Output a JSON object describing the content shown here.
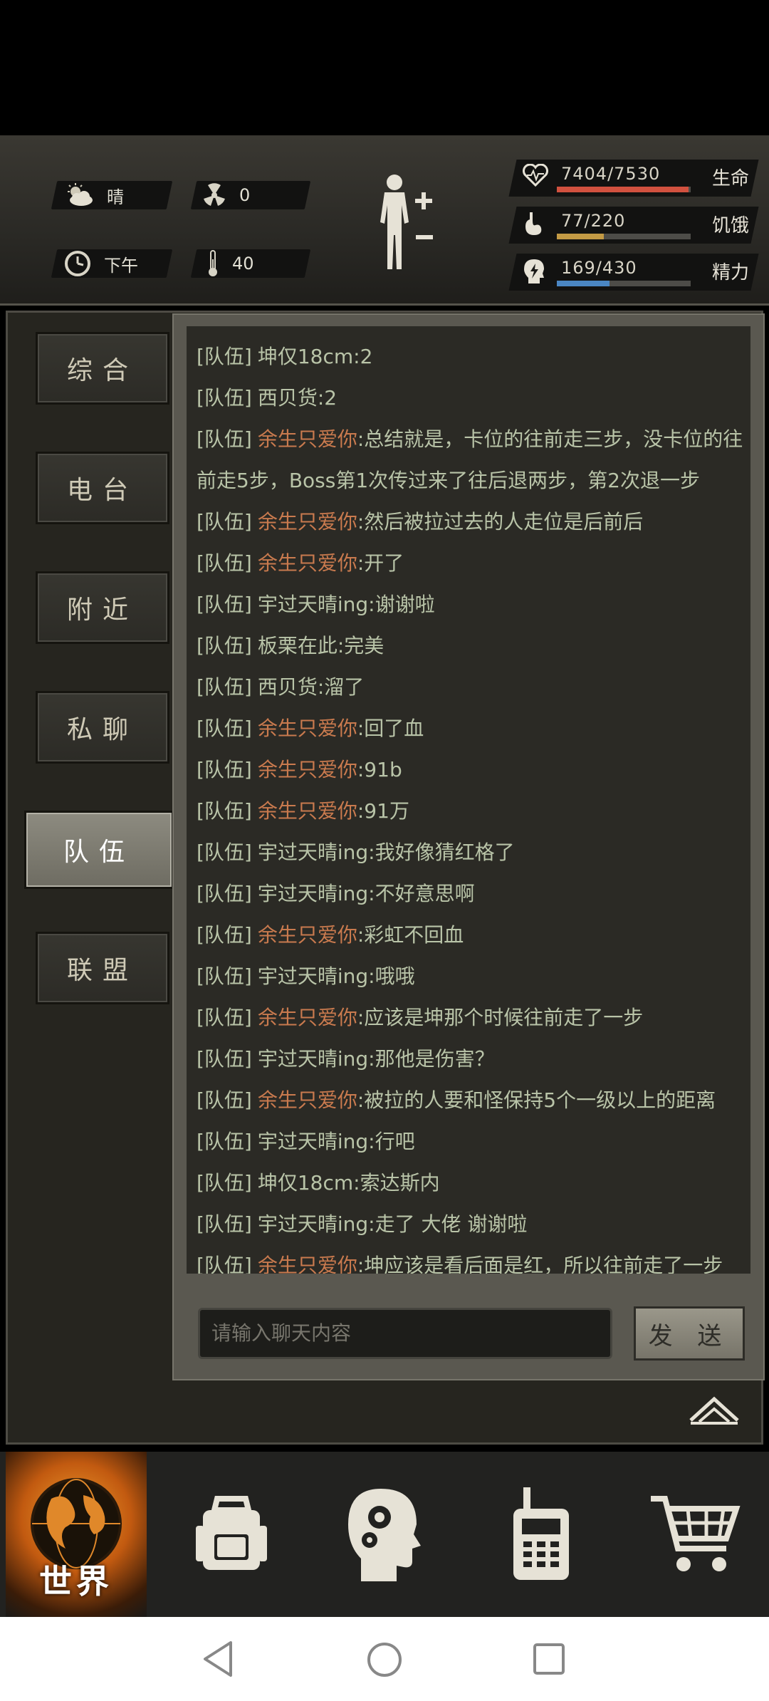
{
  "hud": {
    "weather": "晴",
    "radiation": "0",
    "time_of_day": "下午",
    "temperature": "40",
    "health": {
      "value": "7404/7530",
      "label": "生命",
      "fraction": 0.983,
      "color": "#d1513f"
    },
    "hunger": {
      "value": "77/220",
      "label": "饥饿",
      "fraction": 0.35,
      "color": "#c39a44"
    },
    "energy": {
      "value": "169/430",
      "label": "精力",
      "fraction": 0.393,
      "color": "#4a86c3"
    }
  },
  "tabs": [
    {
      "label": "综合"
    },
    {
      "label": "电台"
    },
    {
      "label": "附近"
    },
    {
      "label": "私聊"
    },
    {
      "label": "队伍",
      "active": true
    },
    {
      "label": "联盟"
    }
  ],
  "chat": {
    "tag": "[队伍]",
    "messages": [
      {
        "name": "坤仅18cm",
        "sender_color": "#b9c4a8",
        "text": ":2"
      },
      {
        "name": "西贝货",
        "sender_color": "#b9c4a8",
        "text": ":2"
      },
      {
        "name": "余生只爱你",
        "sender_color": "#c97a4e",
        "text": ":总结就是，卡位的往前走三步，没卡位的往前走5步，Boss第1次传过来了往后退两步，第2次退一步"
      },
      {
        "name": "余生只爱你",
        "sender_color": "#c97a4e",
        "text": ":然后被拉过去的人走位是后前后"
      },
      {
        "name": "余生只爱你",
        "sender_color": "#c97a4e",
        "text": ":开了"
      },
      {
        "name": "宇过天晴ing",
        "sender_color": "#b9c4a8",
        "text": ":谢谢啦"
      },
      {
        "name": "板栗在此",
        "sender_color": "#b9c4a8",
        "text": ":完美"
      },
      {
        "name": "西贝货",
        "sender_color": "#b9c4a8",
        "text": ":溜了"
      },
      {
        "name": "余生只爱你",
        "sender_color": "#c97a4e",
        "text": ":回了血"
      },
      {
        "name": "余生只爱你",
        "sender_color": "#c97a4e",
        "text": ":91b"
      },
      {
        "name": "余生只爱你",
        "sender_color": "#c97a4e",
        "text": ":91万"
      },
      {
        "name": "宇过天晴ing",
        "sender_color": "#b9c4a8",
        "text": ":我好像猜红格了"
      },
      {
        "name": "宇过天晴ing",
        "sender_color": "#b9c4a8",
        "text": ":不好意思啊"
      },
      {
        "name": "余生只爱你",
        "sender_color": "#c97a4e",
        "text": ":彩虹不回血"
      },
      {
        "name": "宇过天晴ing",
        "sender_color": "#b9c4a8",
        "text": ":哦哦"
      },
      {
        "name": "余生只爱你",
        "sender_color": "#c97a4e",
        "text": ":应该是坤那个时候往前走了一步"
      },
      {
        "name": "宇过天晴ing",
        "sender_color": "#b9c4a8",
        "text": ":那他是伤害？"
      },
      {
        "name": "余生只爱你",
        "sender_color": "#c97a4e",
        "text": ":被拉的人要和怪保持5个一级以上的距离"
      },
      {
        "name": "宇过天晴ing",
        "sender_color": "#b9c4a8",
        "text": ":行吧"
      },
      {
        "name": "坤仅18cm",
        "sender_color": "#b9c4a8",
        "text": ":索达斯内"
      },
      {
        "name": "宇过天晴ing",
        "sender_color": "#b9c4a8",
        "text": ":走了 大佬 谢谢啦"
      },
      {
        "name": "余生只爱你",
        "sender_color": "#c97a4e",
        "text": ":坤应该是看后面是红，所以往前走了一步"
      }
    ],
    "input_placeholder": "请输入聊天内容",
    "send_label": "发 送"
  },
  "bottom_nav": {
    "world_label": "世界",
    "items": [
      "world-globe-icon",
      "backpack-icon",
      "skills-head-icon",
      "walkie-talkie-icon",
      "shopping-cart-icon"
    ]
  },
  "system_nav": [
    "back-icon",
    "home-icon",
    "recents-icon"
  ]
}
